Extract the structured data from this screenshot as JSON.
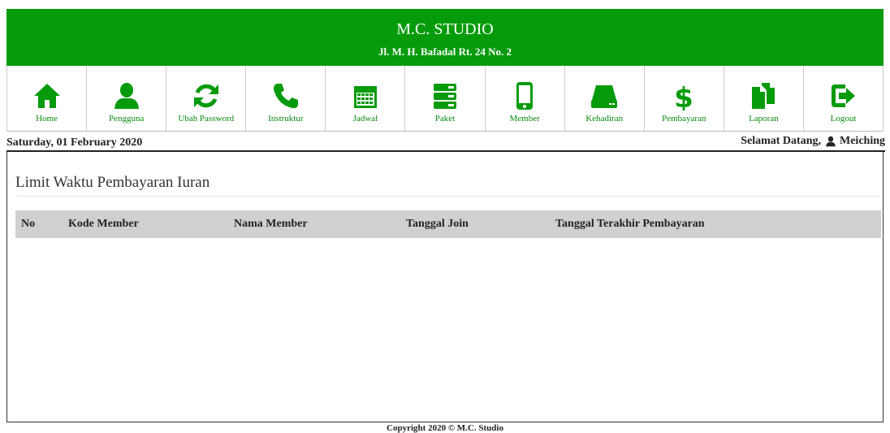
{
  "header": {
    "title": "M.C. STUDIO",
    "address": "Jl. M. H. Bafadal Rt. 24 No. 2",
    "bg_color": "#069b0b"
  },
  "nav": {
    "items": [
      {
        "label": "Home",
        "icon": "home-icon"
      },
      {
        "label": "Pengguna",
        "icon": "user-icon"
      },
      {
        "label": "Ubah Password",
        "icon": "refresh-icon"
      },
      {
        "label": "Instruktur",
        "icon": "phone-icon"
      },
      {
        "label": "Jadwal",
        "icon": "calendar-icon"
      },
      {
        "label": "Paket",
        "icon": "server-icon"
      },
      {
        "label": "Member",
        "icon": "mobile-icon"
      },
      {
        "label": "Kehadiran",
        "icon": "hdd-icon"
      },
      {
        "label": "Pembayaran",
        "icon": "dollar-icon"
      },
      {
        "label": "Laporan",
        "icon": "documents-icon"
      },
      {
        "label": "Logout",
        "icon": "logout-icon"
      }
    ],
    "icon_color": "#069b0b"
  },
  "datebar": {
    "date": "Saturday, 01 February 2020",
    "welcome": "Selamat Datang,",
    "username": "Meiching"
  },
  "main": {
    "heading": "Limit Waktu Pembayaran Iuran",
    "table": {
      "columns": [
        "No",
        "Kode Member",
        "Nama Member",
        "Tanggal Join",
        "Tanggal Terakhir Pembayaran"
      ],
      "rows": []
    }
  },
  "footer": {
    "text": "Copyright 2020 © M.C. Studio"
  }
}
